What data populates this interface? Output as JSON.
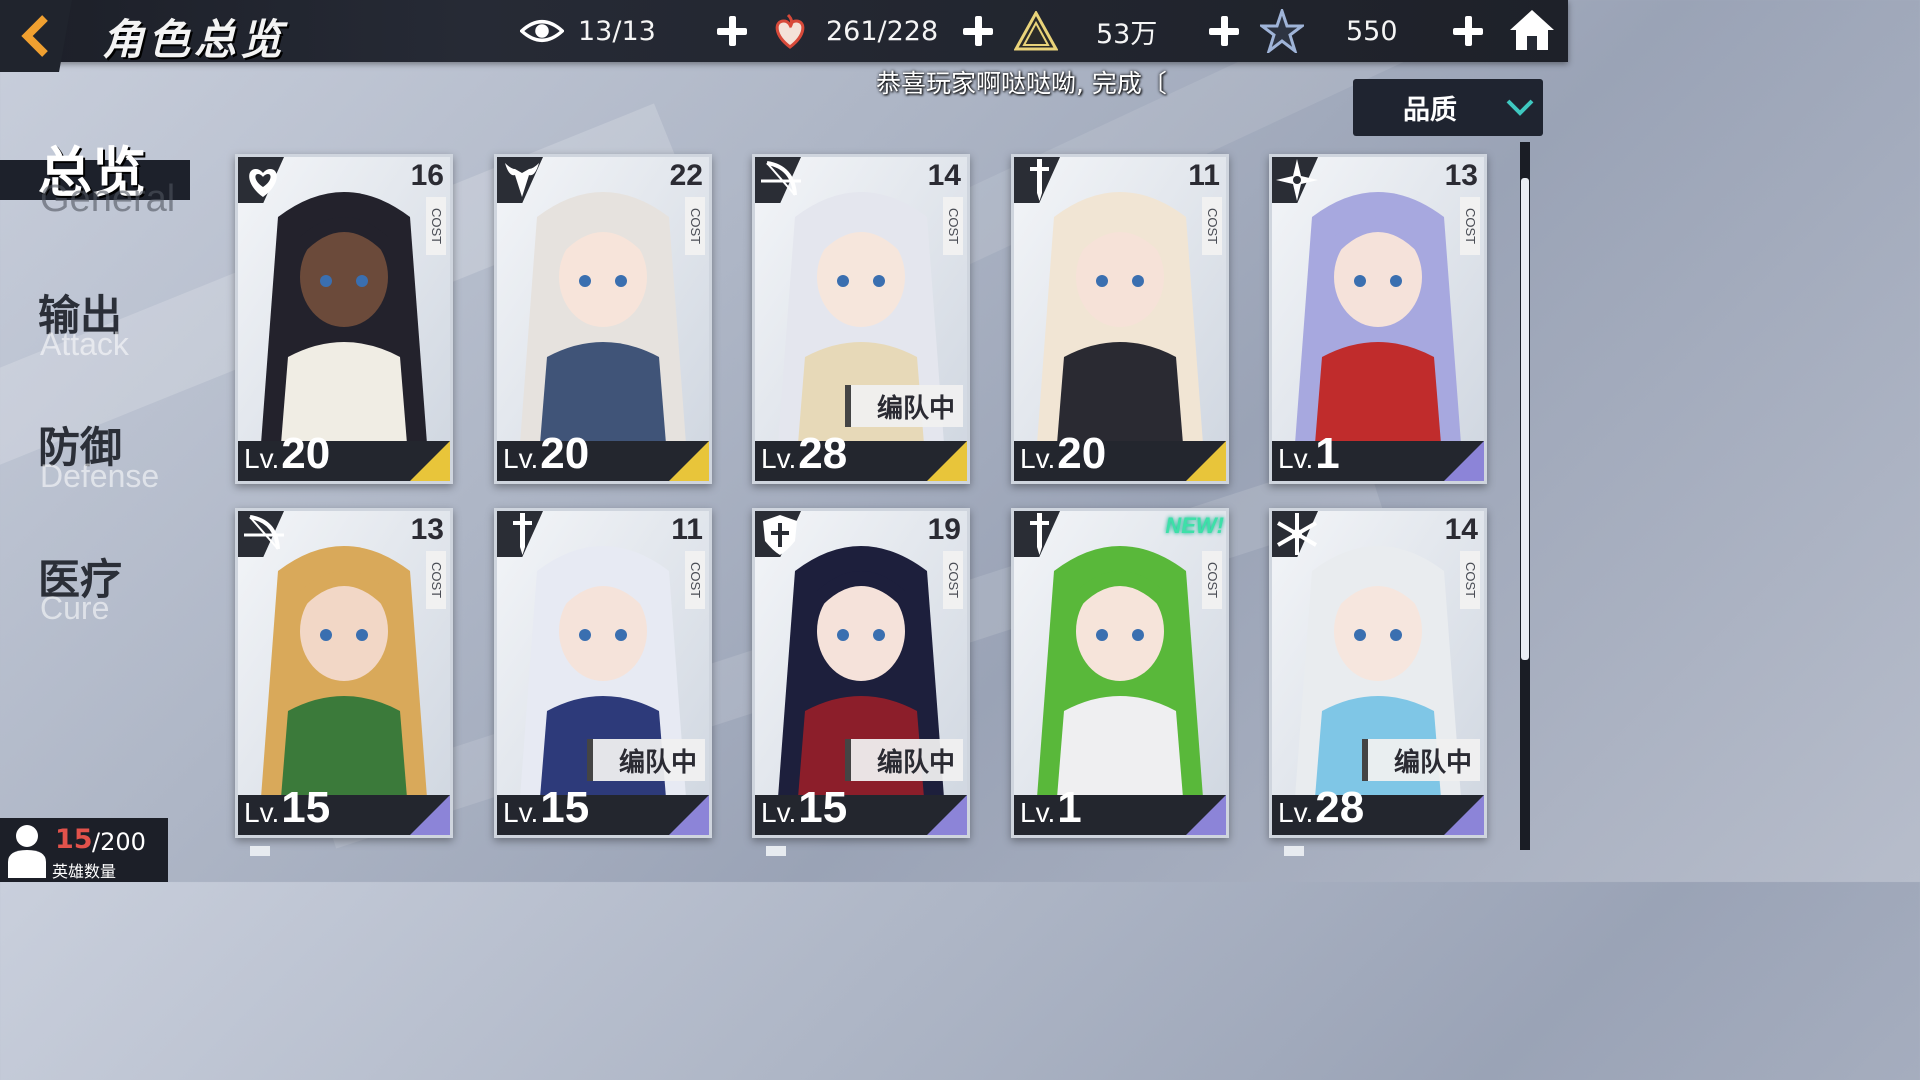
{
  "header": {
    "title": "角色总览",
    "resources": [
      {
        "icon": "eye-icon",
        "value": "13/13"
      },
      {
        "icon": "heart-flame-icon",
        "value": "261/228"
      },
      {
        "icon": "pyramid-icon",
        "value": "53万"
      },
      {
        "icon": "star-crystal-icon",
        "value": "550"
      }
    ]
  },
  "ticker": {
    "text": "恭喜玩家啊哒哒呦, 完成〔"
  },
  "sort": {
    "label": "品质"
  },
  "nav": [
    {
      "cn": "总览",
      "en": "General",
      "active": true
    },
    {
      "cn": "输出",
      "en": "Attack",
      "active": false
    },
    {
      "cn": "防御",
      "en": "Defense",
      "active": false
    },
    {
      "cn": "医疗",
      "en": "Cure",
      "active": false
    }
  ],
  "hero_count": {
    "current": "15",
    "total": "/200",
    "label": "英雄数量"
  },
  "cost_label": "COST",
  "level_prefix": "Lv.",
  "team_label": "编队中",
  "new_label": "NEW!",
  "colors": {
    "gold": "#e8c53a",
    "purple": "#8c84d8",
    "accent": "#f0a030"
  },
  "heroes": [
    {
      "cls": "heart-icon",
      "cost": "16",
      "level": "20",
      "rarity": "gold",
      "team": false,
      "new": false,
      "hair": "#23222c",
      "skin": "#6b4a3a",
      "outfit": "#f0ede4"
    },
    {
      "cls": "demon-icon",
      "cost": "22",
      "level": "20",
      "rarity": "gold",
      "team": false,
      "new": false,
      "hair": "#e6e2de",
      "skin": "#f7e4da",
      "outfit": "#405478"
    },
    {
      "cls": "bow-icon",
      "cost": "14",
      "level": "28",
      "rarity": "gold",
      "team": true,
      "new": false,
      "hair": "#e4e6ee",
      "skin": "#f6e6dc",
      "outfit": "#e7d9b8"
    },
    {
      "cls": "sword-icon",
      "cost": "11",
      "level": "20",
      "rarity": "gold",
      "team": false,
      "new": false,
      "hair": "#f1e5d4",
      "skin": "#f6e2d8",
      "outfit": "#2a2a32"
    },
    {
      "cls": "shuriken-icon",
      "cost": "13",
      "level": "1",
      "rarity": "purple",
      "team": false,
      "new": false,
      "hair": "#a7a8df",
      "skin": "#f5e2da",
      "outfit": "#c02c2c"
    },
    {
      "cls": "bow-icon",
      "cost": "13",
      "level": "15",
      "rarity": "purple",
      "team": false,
      "new": false,
      "hair": "#d9a95a",
      "skin": "#f2d7c6",
      "outfit": "#3b7a3a"
    },
    {
      "cls": "sword-icon",
      "cost": "11",
      "level": "15",
      "rarity": "purple",
      "team": true,
      "new": false,
      "hair": "#e7eaf3",
      "skin": "#f5e3da",
      "outfit": "#2d3a7a"
    },
    {
      "cls": "shield-icon",
      "cost": "19",
      "level": "15",
      "rarity": "purple",
      "team": true,
      "new": false,
      "hair": "#1d1f3c",
      "skin": "#f5e2da",
      "outfit": "#8c1e2a"
    },
    {
      "cls": "sword-icon",
      "cost": "",
      "level": "1",
      "rarity": "purple",
      "team": false,
      "new": true,
      "hair": "#59b83a",
      "skin": "#f6e4da",
      "outfit": "#efeff1"
    },
    {
      "cls": "snowflake-icon",
      "cost": "14",
      "level": "28",
      "rarity": "purple",
      "team": true,
      "new": false,
      "hair": "#e9ecef",
      "skin": "#f6e6de",
      "outfit": "#7fc6e6"
    }
  ]
}
